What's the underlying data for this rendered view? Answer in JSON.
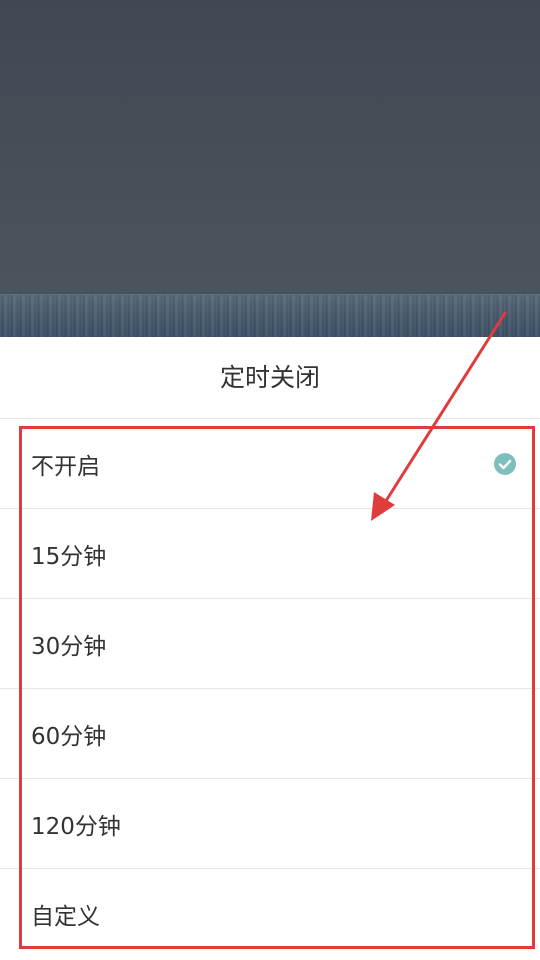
{
  "sheet": {
    "title": "定时关闭"
  },
  "options": [
    {
      "label": "不开启",
      "selected": true
    },
    {
      "label": "15分钟",
      "selected": false
    },
    {
      "label": "30分钟",
      "selected": false
    },
    {
      "label": "60分钟",
      "selected": false
    },
    {
      "label": "120分钟",
      "selected": false
    },
    {
      "label": "自定义",
      "selected": false
    }
  ],
  "colors": {
    "check": "#7fbfbb",
    "annotation": "#e03c3c",
    "text": "#333333"
  },
  "icons": {
    "selected": "check-circle-icon"
  }
}
